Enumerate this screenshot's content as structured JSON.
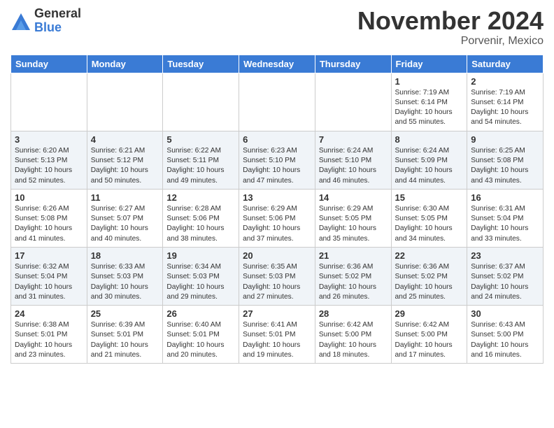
{
  "header": {
    "logo_general": "General",
    "logo_blue": "Blue",
    "month": "November 2024",
    "location": "Porvenir, Mexico"
  },
  "days_of_week": [
    "Sunday",
    "Monday",
    "Tuesday",
    "Wednesday",
    "Thursday",
    "Friday",
    "Saturday"
  ],
  "weeks": [
    [
      {
        "day": "",
        "info": ""
      },
      {
        "day": "",
        "info": ""
      },
      {
        "day": "",
        "info": ""
      },
      {
        "day": "",
        "info": ""
      },
      {
        "day": "",
        "info": ""
      },
      {
        "day": "1",
        "info": "Sunrise: 7:19 AM\nSunset: 6:14 PM\nDaylight: 10 hours\nand 55 minutes."
      },
      {
        "day": "2",
        "info": "Sunrise: 7:19 AM\nSunset: 6:14 PM\nDaylight: 10 hours\nand 54 minutes."
      }
    ],
    [
      {
        "day": "3",
        "info": "Sunrise: 6:20 AM\nSunset: 5:13 PM\nDaylight: 10 hours\nand 52 minutes."
      },
      {
        "day": "4",
        "info": "Sunrise: 6:21 AM\nSunset: 5:12 PM\nDaylight: 10 hours\nand 50 minutes."
      },
      {
        "day": "5",
        "info": "Sunrise: 6:22 AM\nSunset: 5:11 PM\nDaylight: 10 hours\nand 49 minutes."
      },
      {
        "day": "6",
        "info": "Sunrise: 6:23 AM\nSunset: 5:10 PM\nDaylight: 10 hours\nand 47 minutes."
      },
      {
        "day": "7",
        "info": "Sunrise: 6:24 AM\nSunset: 5:10 PM\nDaylight: 10 hours\nand 46 minutes."
      },
      {
        "day": "8",
        "info": "Sunrise: 6:24 AM\nSunset: 5:09 PM\nDaylight: 10 hours\nand 44 minutes."
      },
      {
        "day": "9",
        "info": "Sunrise: 6:25 AM\nSunset: 5:08 PM\nDaylight: 10 hours\nand 43 minutes."
      }
    ],
    [
      {
        "day": "10",
        "info": "Sunrise: 6:26 AM\nSunset: 5:08 PM\nDaylight: 10 hours\nand 41 minutes."
      },
      {
        "day": "11",
        "info": "Sunrise: 6:27 AM\nSunset: 5:07 PM\nDaylight: 10 hours\nand 40 minutes."
      },
      {
        "day": "12",
        "info": "Sunrise: 6:28 AM\nSunset: 5:06 PM\nDaylight: 10 hours\nand 38 minutes."
      },
      {
        "day": "13",
        "info": "Sunrise: 6:29 AM\nSunset: 5:06 PM\nDaylight: 10 hours\nand 37 minutes."
      },
      {
        "day": "14",
        "info": "Sunrise: 6:29 AM\nSunset: 5:05 PM\nDaylight: 10 hours\nand 35 minutes."
      },
      {
        "day": "15",
        "info": "Sunrise: 6:30 AM\nSunset: 5:05 PM\nDaylight: 10 hours\nand 34 minutes."
      },
      {
        "day": "16",
        "info": "Sunrise: 6:31 AM\nSunset: 5:04 PM\nDaylight: 10 hours\nand 33 minutes."
      }
    ],
    [
      {
        "day": "17",
        "info": "Sunrise: 6:32 AM\nSunset: 5:04 PM\nDaylight: 10 hours\nand 31 minutes."
      },
      {
        "day": "18",
        "info": "Sunrise: 6:33 AM\nSunset: 5:03 PM\nDaylight: 10 hours\nand 30 minutes."
      },
      {
        "day": "19",
        "info": "Sunrise: 6:34 AM\nSunset: 5:03 PM\nDaylight: 10 hours\nand 29 minutes."
      },
      {
        "day": "20",
        "info": "Sunrise: 6:35 AM\nSunset: 5:03 PM\nDaylight: 10 hours\nand 27 minutes."
      },
      {
        "day": "21",
        "info": "Sunrise: 6:36 AM\nSunset: 5:02 PM\nDaylight: 10 hours\nand 26 minutes."
      },
      {
        "day": "22",
        "info": "Sunrise: 6:36 AM\nSunset: 5:02 PM\nDaylight: 10 hours\nand 25 minutes."
      },
      {
        "day": "23",
        "info": "Sunrise: 6:37 AM\nSunset: 5:02 PM\nDaylight: 10 hours\nand 24 minutes."
      }
    ],
    [
      {
        "day": "24",
        "info": "Sunrise: 6:38 AM\nSunset: 5:01 PM\nDaylight: 10 hours\nand 23 minutes."
      },
      {
        "day": "25",
        "info": "Sunrise: 6:39 AM\nSunset: 5:01 PM\nDaylight: 10 hours\nand 21 minutes."
      },
      {
        "day": "26",
        "info": "Sunrise: 6:40 AM\nSunset: 5:01 PM\nDaylight: 10 hours\nand 20 minutes."
      },
      {
        "day": "27",
        "info": "Sunrise: 6:41 AM\nSunset: 5:01 PM\nDaylight: 10 hours\nand 19 minutes."
      },
      {
        "day": "28",
        "info": "Sunrise: 6:42 AM\nSunset: 5:00 PM\nDaylight: 10 hours\nand 18 minutes."
      },
      {
        "day": "29",
        "info": "Sunrise: 6:42 AM\nSunset: 5:00 PM\nDaylight: 10 hours\nand 17 minutes."
      },
      {
        "day": "30",
        "info": "Sunrise: 6:43 AM\nSunset: 5:00 PM\nDaylight: 10 hours\nand 16 minutes."
      }
    ]
  ]
}
